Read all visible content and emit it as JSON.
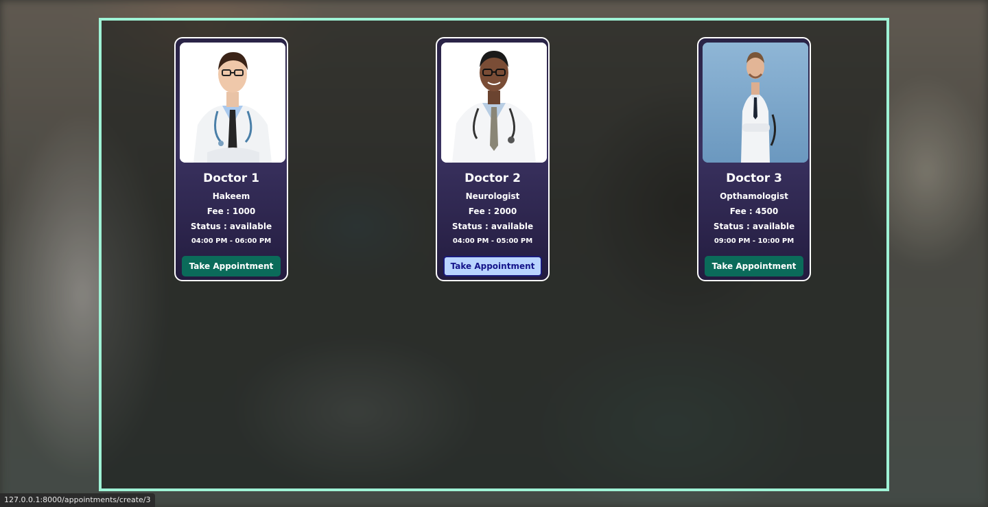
{
  "doctors": [
    {
      "name": "Doctor 1",
      "specialty": "Hakeem",
      "fee": "Fee : 1000",
      "status": "Status : available",
      "time": "04:00 PM - 06:00 PM",
      "button_label": "Take Appointment"
    },
    {
      "name": "Doctor 2",
      "specialty": "Neurologist",
      "fee": "Fee : 2000",
      "status": "Status : available",
      "time": "04:00 PM - 05:00 PM",
      "button_label": "Take Appointment"
    },
    {
      "name": "Doctor 3",
      "specialty": "Opthamologist",
      "fee": "Fee : 4500",
      "status": "Status : available",
      "time": "09:00 PM - 10:00 PM",
      "button_label": "Take Appointment"
    }
  ],
  "status_bar": {
    "url": "127.0.0.1:8000/appointments/create/3"
  },
  "colors": {
    "frame_border": "#9ff3d6",
    "button": "#0b6b5a",
    "button_hover": "#b9d4ff"
  }
}
